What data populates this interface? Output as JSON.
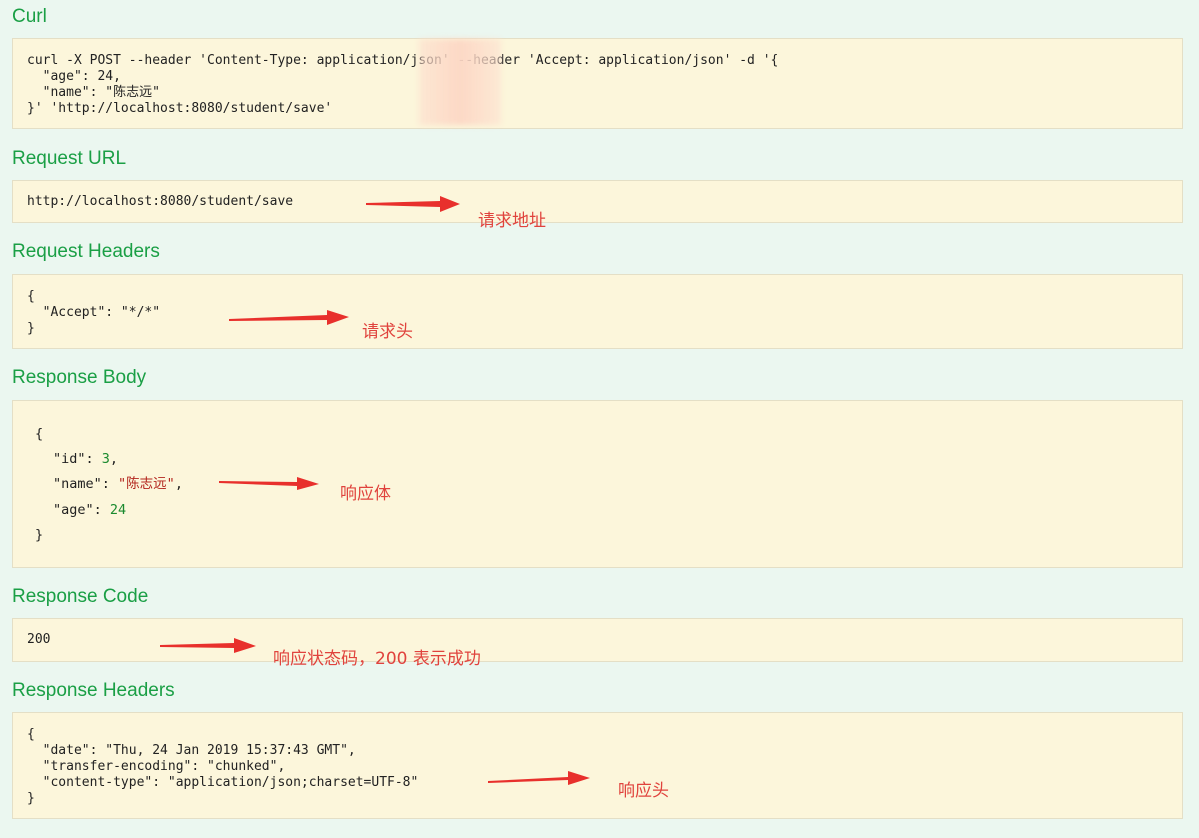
{
  "sections": {
    "curl": {
      "title": "Curl",
      "lines": [
        "curl -X POST --header 'Content-Type: application/json' --header 'Accept: application/json' -d '{",
        "  \"age\": 24,",
        "  \"name\": \"陈志远\"",
        "}' 'http://localhost:8080/student/save'"
      ]
    },
    "request_url": {
      "title": "Request URL",
      "value": "http://localhost:8080/student/save",
      "annotation": "请求地址"
    },
    "request_headers": {
      "title": "Request Headers",
      "lines": [
        "{",
        "  \"Accept\": \"*/*\"",
        "}"
      ],
      "annotation": "请求头"
    },
    "response_body": {
      "title": "Response Body",
      "open": "{",
      "close": "}",
      "fields": [
        {
          "key": "\"id\"",
          "value": "3",
          "type": "num",
          "trail": ","
        },
        {
          "key": "\"name\"",
          "value": "\"陈志远\"",
          "type": "str",
          "trail": ","
        },
        {
          "key": "\"age\"",
          "value": "24",
          "type": "num",
          "trail": ""
        }
      ],
      "annotation": "响应体"
    },
    "response_code": {
      "title": "Response Code",
      "value": "200",
      "annotation": "响应状态码，200 表示成功"
    },
    "response_headers": {
      "title": "Response Headers",
      "lines": [
        "{",
        "  \"date\": \"Thu, 24 Jan 2019 15:37:43 GMT\",",
        "  \"transfer-encoding\": \"chunked\",",
        "  \"content-type\": \"application/json;charset=UTF-8\"",
        "}"
      ],
      "annotation": "响应头"
    }
  },
  "colors": {
    "background": "#ebf7f0",
    "title": "#1a9f45",
    "box": "#fcf6db",
    "annotation": "#e0433d",
    "number": "#1a8a2e",
    "string": "#b3261e"
  }
}
